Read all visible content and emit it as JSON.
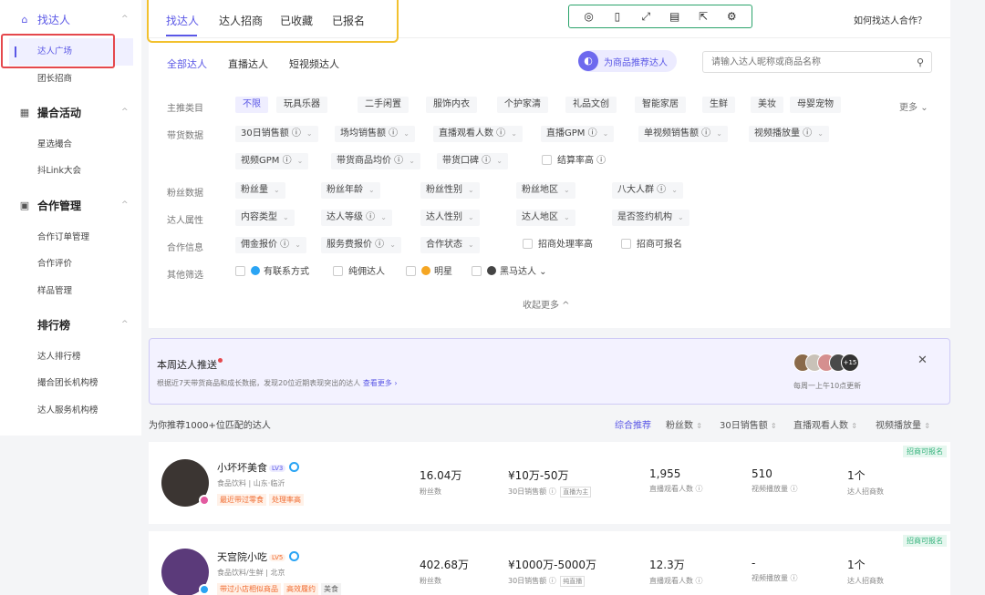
{
  "sidebar": {
    "groups": [
      {
        "label": "找达人",
        "icon": "home-icon"
      },
      {
        "label": "撮合活动",
        "icon": "calendar-icon"
      },
      {
        "label": "合作管理",
        "icon": "briefcase-icon"
      },
      {
        "label": "排行榜",
        "icon": ""
      }
    ],
    "items": [
      "达人广场",
      "团长招商",
      "星选撮合",
      "抖Link大会",
      "合作订单管理",
      "合作评价",
      "样品管理",
      "达人排行榜",
      "撮合团长机构榜",
      "达人服务机构榜"
    ]
  },
  "tabs": [
    "找达人",
    "达人招商",
    "已收藏",
    "已报名"
  ],
  "help_link": "如何找达人合作？",
  "subtabs": [
    "全部达人",
    "直播达人",
    "短视频达人"
  ],
  "recommend": {
    "label": "为商品推荐达人"
  },
  "search": {
    "placeholder": "请输入达人昵称或商品名称"
  },
  "filters": {
    "category_label": "主推类目",
    "categories": [
      "不限",
      "玩具乐器",
      "二手闲置",
      "服饰内衣",
      "个护家清",
      "礼品文创",
      "智能家居",
      "生鲜",
      "美妆",
      "母婴宠物"
    ],
    "more": "更多",
    "sales_label": "带货数据",
    "sales_row1": [
      "30日销售额",
      "场均销售额",
      "直播观看人数",
      "直播GPM",
      "单视频销售额",
      "视频播放量"
    ],
    "sales_row2": [
      "视频GPM",
      "带货商品均价",
      "带货口碑"
    ],
    "settle_cb": "结算率高",
    "fans_label": "粉丝数据",
    "fans": [
      "粉丝量",
      "粉丝年龄",
      "粉丝性别",
      "粉丝地区",
      "八大人群"
    ],
    "attr_label": "达人属性",
    "attrs": [
      "内容类型",
      "达人等级",
      "达人性别",
      "达人地区",
      "是否签约机构"
    ],
    "coop_label": "合作信息",
    "coop": [
      "佣金报价",
      "服务费报价",
      "合作状态"
    ],
    "coop_cb": [
      "招商处理率高",
      "招商可报名"
    ],
    "other_label": "其他筛选",
    "other_cb": [
      "有联系方式",
      "纯佣达人",
      "明星",
      "黑马达人"
    ],
    "collapse": "收起更多 ^"
  },
  "weekly": {
    "title": "本周达人推送",
    "desc": "根据近7天带货商品和成长数据，发现20位近期表现突出的达人",
    "link": "查看更多 ›",
    "badge_count": "+15",
    "update": "每周一上午10点更新"
  },
  "list": {
    "header": "为你推荐1000+位匹配的达人",
    "sorts": [
      "综合推荐",
      "粉丝数",
      "30日销售额",
      "直播观看人数",
      "视频播放量"
    ]
  },
  "creators": [
    {
      "name": "小坏坏美食",
      "level": "LV3",
      "meta": "食品饮料 | 山东·临沂",
      "badges": [
        "最近带过零食",
        "处理率高"
      ],
      "tag": "招商可报名",
      "fans": "16.04万",
      "fans_label": "粉丝数",
      "sales": "¥10万-50万",
      "sales_label": "30日销售额",
      "sales_pill": "直播为主",
      "live": "1,955",
      "live_label": "直播观看人数",
      "video": "510",
      "video_label": "视频播放量",
      "invites": "1个",
      "invites_label": "达人招商数"
    },
    {
      "name": "天宫院小吃",
      "level": "LV5",
      "meta": "食品饮料/生鲜 | 北京",
      "badges": [
        "带过小店相似商品",
        "高效履约",
        "美食"
      ],
      "tag": "招商可报名",
      "fans": "402.68万",
      "fans_label": "粉丝数",
      "sales": "¥1000万-5000万",
      "sales_label": "30日销售额",
      "sales_pill": "纯直播",
      "live": "12.3万",
      "live_label": "直播观看人数",
      "video": "-",
      "video_label": "视频播放量",
      "invites": "1个",
      "invites_label": "达人招商数"
    }
  ],
  "colors": {
    "accent": "#5a57e6",
    "highlight_red": "#e5484d",
    "highlight_yellow": "#f2c12e",
    "toolbar_green": "#2aa36b",
    "tag_green": "#34b27b"
  }
}
